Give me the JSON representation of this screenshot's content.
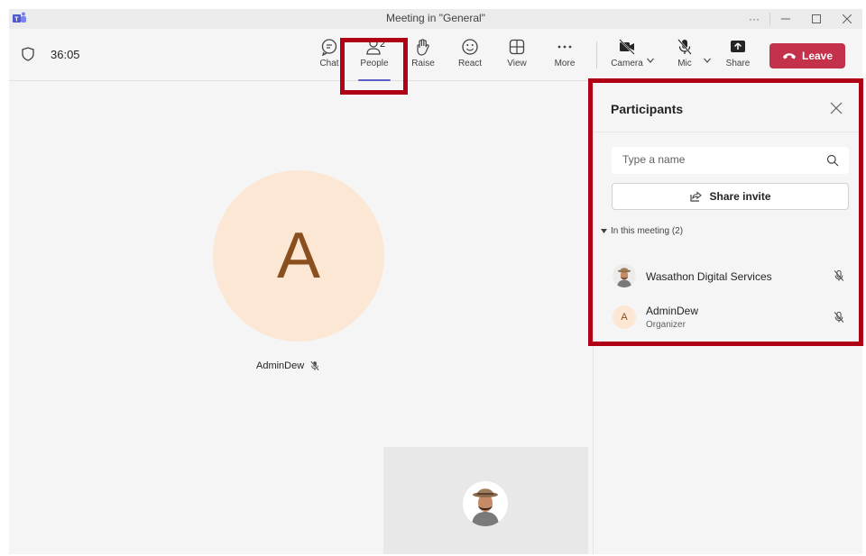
{
  "window": {
    "title": "Meeting in \"General\"",
    "controls": [
      "more",
      "minimize",
      "maximize",
      "close"
    ]
  },
  "toolbar": {
    "timer": "36:05",
    "chat_label": "Chat",
    "people_label": "People",
    "people_count": "2",
    "raise_label": "Raise",
    "react_label": "React",
    "view_label": "View",
    "more_label": "More",
    "camera_label": "Camera",
    "mic_label": "Mic",
    "share_label": "Share",
    "leave_label": "Leave",
    "leave_color": "#c4314b",
    "active_tab": "People",
    "active_indicator_color": "#5b5fc7"
  },
  "stage": {
    "main_avatar_initial": "A",
    "main_name": "AdminDew",
    "avatar_bg": "#fbe7d4",
    "avatar_fg": "#8a4f1e"
  },
  "participants": {
    "title": "Participants",
    "search_placeholder": "Type a name",
    "share_invite_label": "Share invite",
    "section_label": "In this meeting (2)",
    "list": [
      {
        "name": "Wasathon Digital Services",
        "role": "",
        "avatar": "photo",
        "muted": true
      },
      {
        "name": "AdminDew",
        "role": "Organizer",
        "avatar": "A",
        "muted": true
      }
    ]
  },
  "annotation_color": "#b00015"
}
